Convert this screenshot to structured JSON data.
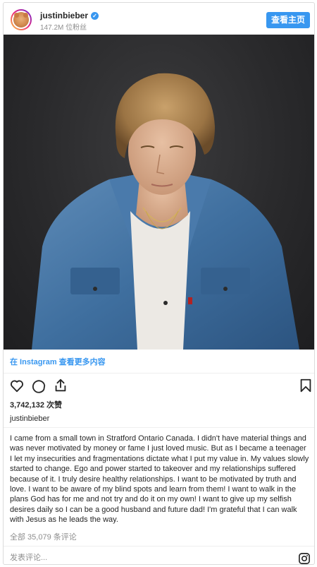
{
  "header": {
    "username": "justinbieber",
    "verified_mark": "✓",
    "followers": "147.2M 位粉丝",
    "view_profile": "查看主页"
  },
  "post": {
    "view_more": "在 Instagram 查看更多内容",
    "likes": "3,742,132 次赞",
    "caption_username": "justinbieber",
    "caption": "I came from a small town in Stratford Ontario Canada. I didn't have material things and was never motivated by money or fame I just loved music. But as I became a teenager I let my insecurities and fragmentations dictate what I put my value in. My values slowly started to change. Ego and power started to takeover and my relationships suffered because of it. I truly desire healthy relationships. I want to be motivated by truth and love. I want to be aware of my blind spots and learn from them! I want to walk in the plans God has for me and not try and do it on my own! I want to give up my selfish desires daily so I can be a good husband and future dad! I'm grateful that I can walk with Jesus as he leads the way.",
    "comments": "全部 35,079 条评论",
    "comment_placeholder": "发表评论..."
  },
  "icons": {
    "like": "heart-icon",
    "comment": "comment-icon",
    "share": "share-icon",
    "save": "bookmark-icon",
    "brand": "instagram-icon"
  },
  "colors": {
    "accent": "#3897f0",
    "text": "#262626",
    "muted": "#8e8e8e",
    "border": "#dbdbdb"
  }
}
